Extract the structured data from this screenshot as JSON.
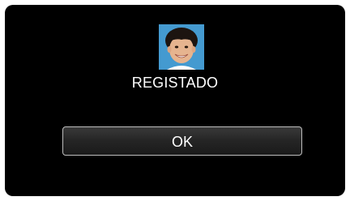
{
  "dialog": {
    "status_text": "REGISTADO",
    "ok_label": "OK",
    "thumbnail_icon": "registered-face-thumbnail"
  },
  "colors": {
    "screen_background": "#000000",
    "text": "#ffffff",
    "button_border": "#bdbdbd",
    "thumbnail_background": "#3a8fc8"
  }
}
